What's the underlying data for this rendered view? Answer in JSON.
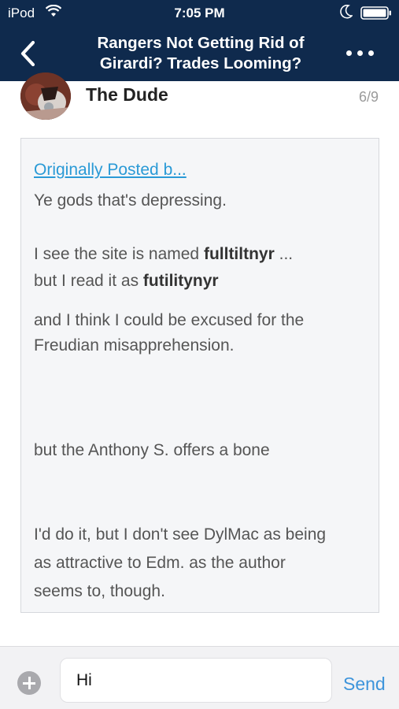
{
  "status_bar": {
    "carrier": "iPod",
    "time": "7:05 PM"
  },
  "nav": {
    "back_icon": "chevron-left-icon",
    "title": "Rangers Not Getting Rid of Girardi? Trades Looming?",
    "more_icon": "ellipsis-icon"
  },
  "post": {
    "author": "The Dude",
    "index": "6/9",
    "quote": {
      "link": "Originally Posted b...",
      "line1": "Ye gods that's depressing.",
      "line2_prefix": "I see the site is named ",
      "line2_bold": "fulltiltnyr",
      "line2_suffix": " ...",
      "line3_prefix": "but I read it as ",
      "line3_bold": "futilitynyr",
      "line4": "and I think I could be excused for the Freudian misapprehension.",
      "line5": "but the Anthony S. offers a bone",
      "line6": "I'd do it, but I don't see DylMac as being as attractive to Edm. as the author seems to, though."
    }
  },
  "composer": {
    "add_icon": "plus-circle-icon",
    "input_value": "Hi",
    "send_label": "Send"
  },
  "colors": {
    "nav_bg": "#0f2a4d",
    "link": "#2a9ad6",
    "send": "#3d94db"
  }
}
